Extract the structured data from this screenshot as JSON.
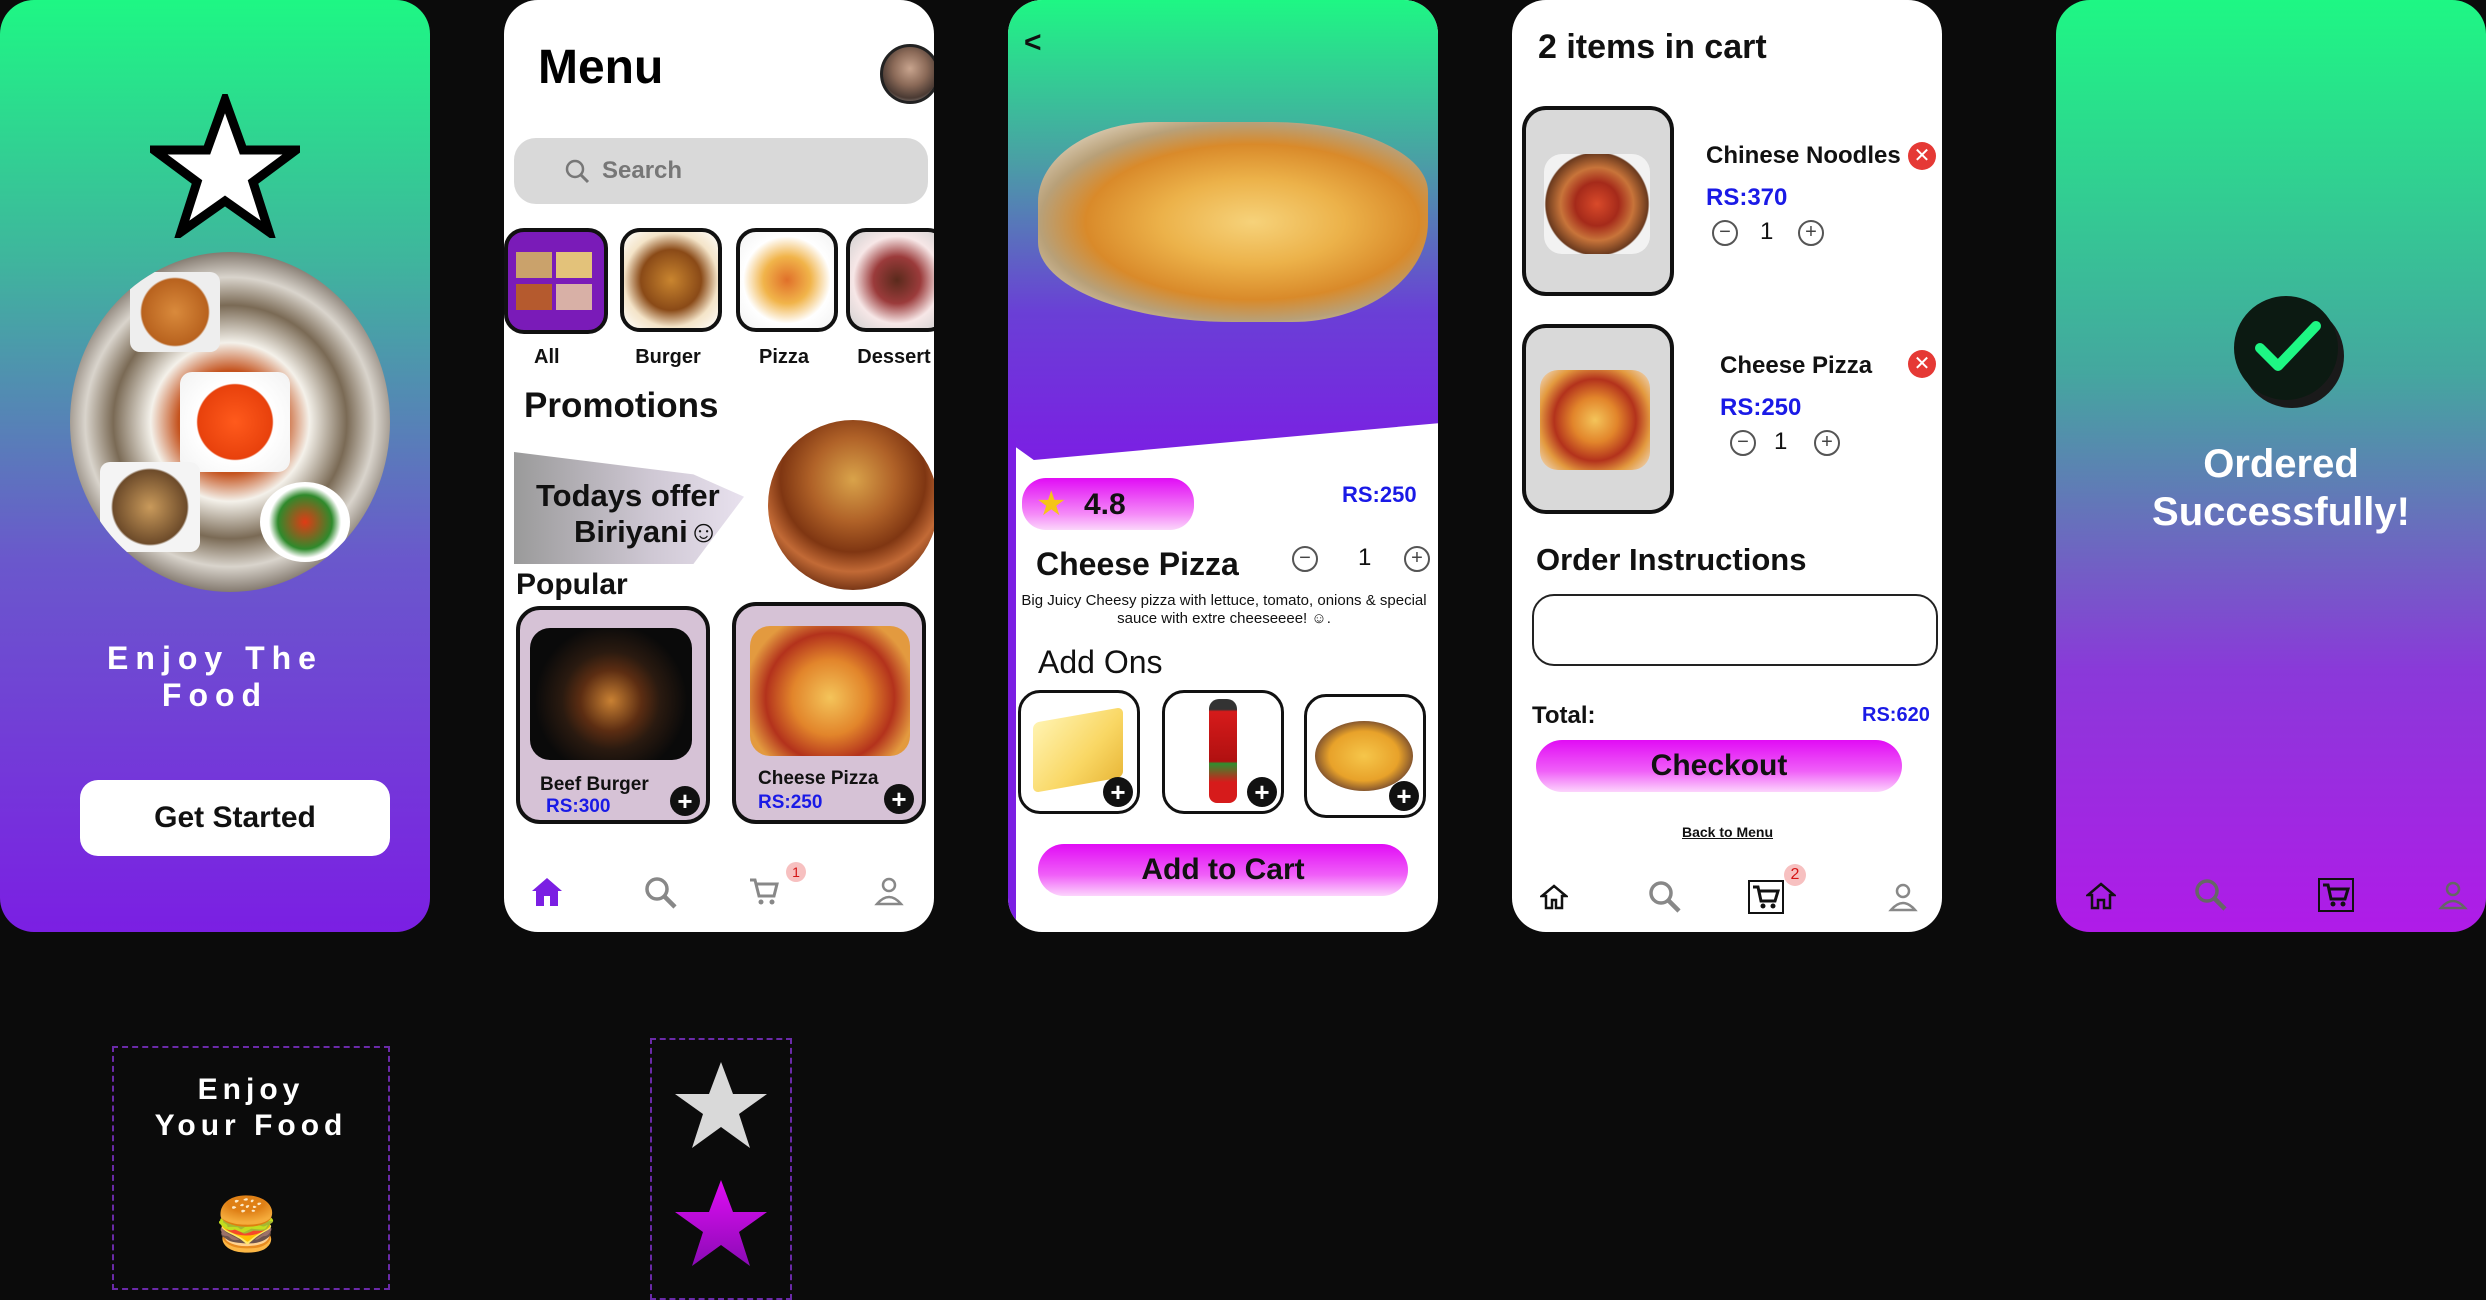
{
  "splash": {
    "tagline": "Enjoy The Food",
    "cta": "Get Started"
  },
  "menu": {
    "title": "Menu",
    "search_placeholder": "Search",
    "categories": [
      {
        "label": "All"
      },
      {
        "label": "Burger"
      },
      {
        "label": "Pizza"
      },
      {
        "label": "Dessert"
      }
    ],
    "promotions_title": "Promotions",
    "promo_line1": "Todays offer",
    "promo_line2": "Biriyani☺",
    "popular_title": "Popular",
    "popular": [
      {
        "name": "Beef Burger",
        "price": "RS:300"
      },
      {
        "name": "Cheese Pizza",
        "price": "RS:250"
      }
    ],
    "cart_badge": "1"
  },
  "detail": {
    "back": "<",
    "rating": "4.8",
    "price": "RS:250",
    "name": "Cheese Pizza",
    "qty": "1",
    "description": "Big Juicy Cheesy pizza with lettuce, tomato, onions & special sauce with extre cheeseeee! ☺.",
    "addons_title": "Add Ons",
    "add_to_cart": "Add to Cart"
  },
  "cart": {
    "title": "2 items in cart",
    "items": [
      {
        "name": "Chinese Noodles",
        "price": "RS:370",
        "qty": "1"
      },
      {
        "name": "Cheese Pizza",
        "price": "RS:250",
        "qty": "1"
      }
    ],
    "instructions_title": "Order Instructions",
    "total_label": "Total:",
    "total_value": "RS:620",
    "checkout": "Checkout",
    "back_to_menu": "Back to Menu",
    "cart_badge": "2"
  },
  "success": {
    "line1": "Ordered",
    "line2": "Successfully!"
  },
  "components": {
    "logo_line1": "Enjoy",
    "logo_line2": "Your Food",
    "logo_emoji": "🍔"
  },
  "colors": {
    "accent_purple": "#7b1fe3",
    "accent_green": "#1ef784",
    "magenta": "#e10cf5",
    "price_blue": "#1a1ae6"
  }
}
